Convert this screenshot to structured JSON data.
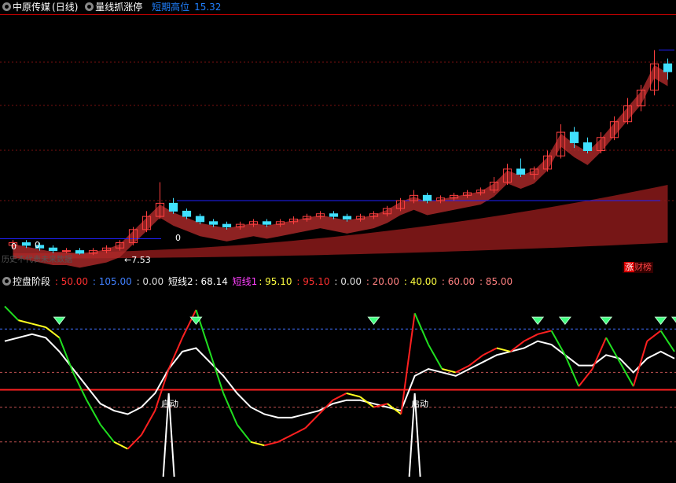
{
  "top_legend": {
    "stock_name": "中原传媒",
    "period": "(日线)",
    "indicator_name": "量线抓涨停",
    "top_label": "短期高位",
    "top_value": "15.32"
  },
  "price_annotations": {
    "low_arrow": "←7.53",
    "zero_marks": [
      "0",
      "0",
      "0"
    ],
    "faded_text": "历史不代表未来数据",
    "badge_main": "涨",
    "badge_sub": "财榜"
  },
  "low_legend": {
    "indicator_name": "控盘阶段",
    "v1": ": 50.00",
    "v2": ": 105.00",
    "v3": ": 0.00",
    "short2_label": "短线2",
    "short2_value": ": 68.14",
    "short1_label": "短线1",
    "short1_value": ": 95.10",
    "v4": ": 95.10",
    "v5": ": 0.00",
    "v6": ": 20.00",
    "v7": ": 40.00",
    "v8": ": 60.00",
    "v9": ": 85.00"
  },
  "start_labels": [
    "启动",
    "启动"
  ],
  "colors": {
    "bull": "#ff4040",
    "bear": "#40e0ff",
    "ribbon_red": "#8b1a1a",
    "ribbon_green": "#5a7a40",
    "line_white": "#ffffff",
    "line_red": "#ff2020",
    "line_green": "#20e020",
    "line_yellow": "#ffff20",
    "ref_blue": "#2020ff",
    "gem_green": "#40ff80"
  },
  "chart_data": {
    "type": "candlestick-with-oscillator",
    "price": {
      "high_marker": 15.32,
      "low_marker": 7.53,
      "candles": [
        [
          7.9,
          8.1,
          7.8,
          8.0
        ],
        [
          8.0,
          8.1,
          7.8,
          7.9
        ],
        [
          7.9,
          8.0,
          7.7,
          7.8
        ],
        [
          7.8,
          7.9,
          7.6,
          7.7
        ],
        [
          7.7,
          7.8,
          7.6,
          7.7
        ],
        [
          7.7,
          7.8,
          7.55,
          7.6
        ],
        [
          7.6,
          7.8,
          7.53,
          7.7
        ],
        [
          7.7,
          7.9,
          7.6,
          7.8
        ],
        [
          7.8,
          8.1,
          7.7,
          8.0
        ],
        [
          8.0,
          8.6,
          7.9,
          8.5
        ],
        [
          8.5,
          9.2,
          8.4,
          9.0
        ],
        [
          9.0,
          10.3,
          8.9,
          9.5
        ],
        [
          9.5,
          9.7,
          9.1,
          9.2
        ],
        [
          9.2,
          9.3,
          8.9,
          9.0
        ],
        [
          9.0,
          9.1,
          8.7,
          8.8
        ],
        [
          8.8,
          8.9,
          8.6,
          8.7
        ],
        [
          8.7,
          8.8,
          8.5,
          8.6
        ],
        [
          8.6,
          8.8,
          8.5,
          8.7
        ],
        [
          8.7,
          8.9,
          8.6,
          8.8
        ],
        [
          8.8,
          8.9,
          8.6,
          8.7
        ],
        [
          8.7,
          8.9,
          8.6,
          8.8
        ],
        [
          8.8,
          9.0,
          8.7,
          8.9
        ],
        [
          8.9,
          9.1,
          8.8,
          9.0
        ],
        [
          9.0,
          9.2,
          8.9,
          9.1
        ],
        [
          9.1,
          9.2,
          8.9,
          9.0
        ],
        [
          9.0,
          9.1,
          8.8,
          8.9
        ],
        [
          8.9,
          9.1,
          8.8,
          9.0
        ],
        [
          9.0,
          9.2,
          8.9,
          9.1
        ],
        [
          9.1,
          9.4,
          9.0,
          9.3
        ],
        [
          9.3,
          9.7,
          9.2,
          9.6
        ],
        [
          9.6,
          10.0,
          9.5,
          9.8
        ],
        [
          9.8,
          9.9,
          9.5,
          9.6
        ],
        [
          9.6,
          9.8,
          9.5,
          9.7
        ],
        [
          9.7,
          9.9,
          9.6,
          9.8
        ],
        [
          9.8,
          10.0,
          9.7,
          9.9
        ],
        [
          9.9,
          10.1,
          9.8,
          10.0
        ],
        [
          10.0,
          10.5,
          9.9,
          10.3
        ],
        [
          10.3,
          11.0,
          10.2,
          10.8
        ],
        [
          10.8,
          11.2,
          10.5,
          10.6
        ],
        [
          10.6,
          10.9,
          10.4,
          10.8
        ],
        [
          10.8,
          11.5,
          10.7,
          11.3
        ],
        [
          11.3,
          12.5,
          11.2,
          12.2
        ],
        [
          12.2,
          12.4,
          11.6,
          11.8
        ],
        [
          11.8,
          12.0,
          11.4,
          11.5
        ],
        [
          11.5,
          12.2,
          11.4,
          12.0
        ],
        [
          12.0,
          12.8,
          11.9,
          12.6
        ],
        [
          12.6,
          13.5,
          12.5,
          13.2
        ],
        [
          13.2,
          14.0,
          13.0,
          13.8
        ],
        [
          13.8,
          15.32,
          13.6,
          14.8
        ],
        [
          14.8,
          15.0,
          14.2,
          14.5
        ]
      ]
    },
    "oscillator": {
      "series": [
        {
          "name": "短线1",
          "values": [
            98,
            90,
            88,
            86,
            80,
            60,
            44,
            30,
            20,
            16,
            24,
            38,
            62,
            80,
            96,
            72,
            48,
            30,
            20,
            18,
            20,
            24,
            28,
            36,
            44,
            48,
            46,
            40,
            42,
            36,
            94,
            76,
            62,
            60,
            64,
            70,
            74,
            72,
            78,
            82,
            84,
            70,
            52,
            62,
            80,
            66,
            52,
            78,
            84,
            72
          ]
        },
        {
          "name": "短线2",
          "values": [
            78,
            80,
            82,
            80,
            72,
            62,
            52,
            42,
            38,
            36,
            40,
            48,
            62,
            72,
            74,
            66,
            58,
            48,
            40,
            36,
            34,
            34,
            36,
            38,
            42,
            44,
            44,
            42,
            40,
            38,
            58,
            62,
            60,
            58,
            62,
            66,
            70,
            72,
            74,
            78,
            76,
            70,
            64,
            64,
            70,
            68,
            60,
            68,
            72,
            68
          ]
        }
      ],
      "ylim": [
        0,
        105
      ],
      "reference_levels": [
        20,
        40,
        50,
        60,
        85
      ]
    }
  }
}
